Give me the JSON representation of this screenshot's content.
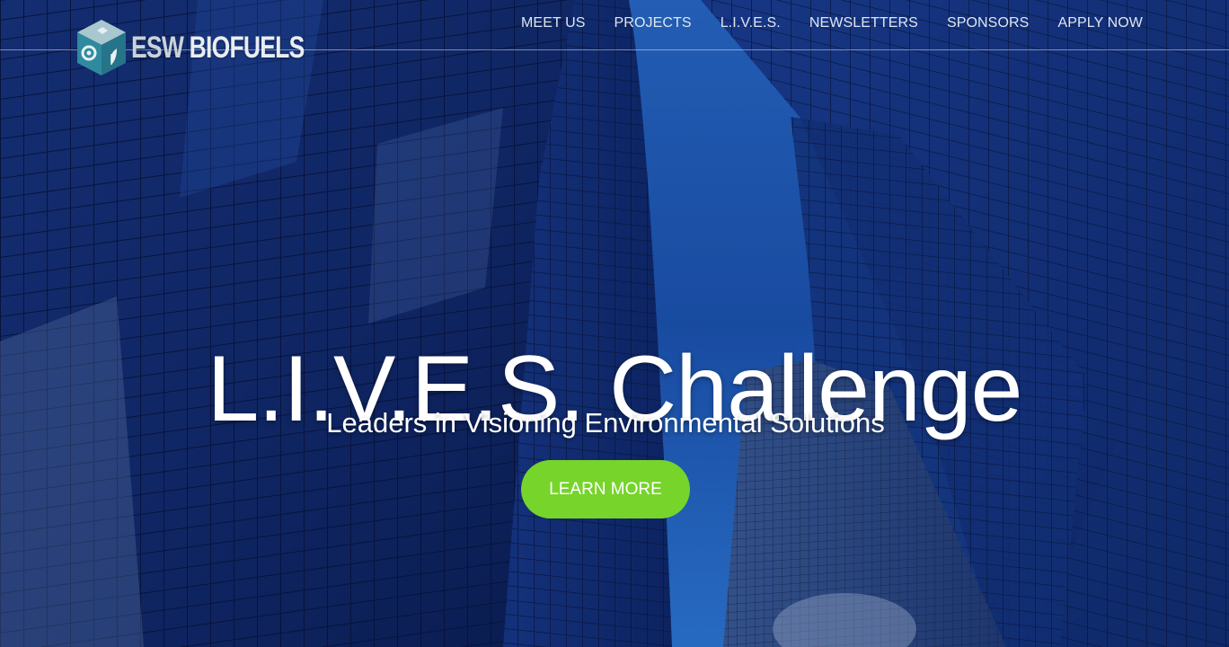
{
  "logo": {
    "text_part1": "ESW",
    "text_part2": "BIOFUELS"
  },
  "nav": {
    "items": [
      "MEET US",
      "PROJECTS",
      "L.I.V.E.S.",
      "NEWSLETTERS",
      "SPONSORS",
      "APPLY NOW"
    ]
  },
  "hero": {
    "title": "L.I.V.E.S. Challenge",
    "subtitle": "Leaders in Visioning Environmental Solutions",
    "cta_label": "LEARN MORE"
  },
  "colors": {
    "cta_green": "#76d42b",
    "sky_blue": "#1e5fc4",
    "glass_dark": "#0e2466"
  }
}
